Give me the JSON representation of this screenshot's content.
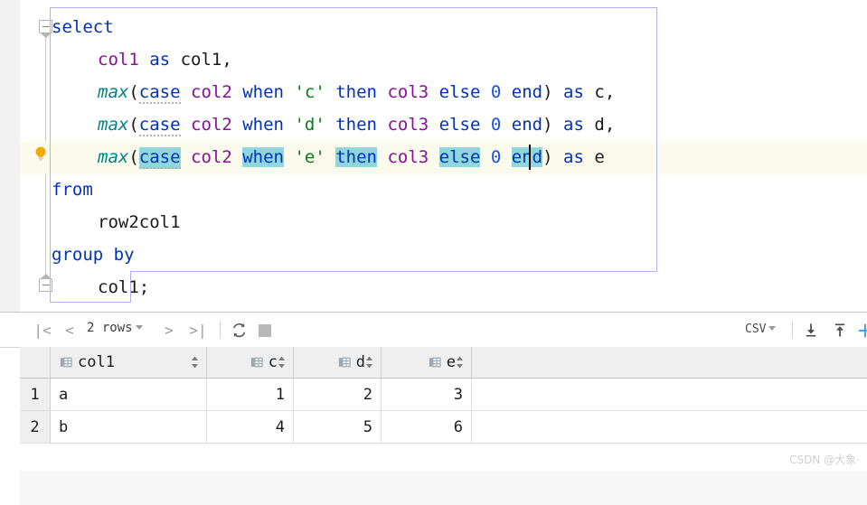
{
  "editor": {
    "language": "sql",
    "lines": [
      {
        "indent": 0,
        "tokens": [
          {
            "t": "select",
            "c": "kw"
          }
        ]
      },
      {
        "indent": 1,
        "tokens": [
          {
            "t": "col1",
            "c": "col"
          },
          {
            "t": " ",
            "c": "pln"
          },
          {
            "t": "as",
            "c": "kw"
          },
          {
            "t": " ",
            "c": "pln"
          },
          {
            "t": "col1",
            "c": "pln"
          },
          {
            "t": ",",
            "c": "pln"
          }
        ]
      },
      {
        "indent": 1,
        "tokens": [
          {
            "t": "max",
            "c": "fn"
          },
          {
            "t": "(",
            "c": "pln"
          },
          {
            "t": "case",
            "c": "kw sq"
          },
          {
            "t": " ",
            "c": "pln"
          },
          {
            "t": "col2",
            "c": "col"
          },
          {
            "t": " ",
            "c": "pln"
          },
          {
            "t": "when",
            "c": "kw"
          },
          {
            "t": " ",
            "c": "pln"
          },
          {
            "t": "'c'",
            "c": "str"
          },
          {
            "t": " ",
            "c": "pln"
          },
          {
            "t": "then",
            "c": "kw"
          },
          {
            "t": " ",
            "c": "pln"
          },
          {
            "t": "col3",
            "c": "col"
          },
          {
            "t": " ",
            "c": "pln"
          },
          {
            "t": "else",
            "c": "kw"
          },
          {
            "t": " ",
            "c": "pln"
          },
          {
            "t": "0",
            "c": "num"
          },
          {
            "t": " ",
            "c": "pln"
          },
          {
            "t": "end",
            "c": "kw"
          },
          {
            "t": ")",
            "c": "pln"
          },
          {
            "t": " ",
            "c": "pln"
          },
          {
            "t": "as",
            "c": "kw"
          },
          {
            "t": " ",
            "c": "pln"
          },
          {
            "t": "c",
            "c": "pln"
          },
          {
            "t": ",",
            "c": "pln"
          }
        ]
      },
      {
        "indent": 1,
        "tokens": [
          {
            "t": "max",
            "c": "fn"
          },
          {
            "t": "(",
            "c": "pln"
          },
          {
            "t": "case",
            "c": "kw sq"
          },
          {
            "t": " ",
            "c": "pln"
          },
          {
            "t": "col2",
            "c": "col"
          },
          {
            "t": " ",
            "c": "pln"
          },
          {
            "t": "when",
            "c": "kw"
          },
          {
            "t": " ",
            "c": "pln"
          },
          {
            "t": "'d'",
            "c": "str"
          },
          {
            "t": " ",
            "c": "pln"
          },
          {
            "t": "then",
            "c": "kw"
          },
          {
            "t": " ",
            "c": "pln"
          },
          {
            "t": "col3",
            "c": "col"
          },
          {
            "t": " ",
            "c": "pln"
          },
          {
            "t": "else",
            "c": "kw"
          },
          {
            "t": " ",
            "c": "pln"
          },
          {
            "t": "0",
            "c": "num"
          },
          {
            "t": " ",
            "c": "pln"
          },
          {
            "t": "end",
            "c": "kw"
          },
          {
            "t": ")",
            "c": "pln"
          },
          {
            "t": " ",
            "c": "pln"
          },
          {
            "t": "as",
            "c": "kw"
          },
          {
            "t": " ",
            "c": "pln"
          },
          {
            "t": "d",
            "c": "pln"
          },
          {
            "t": ",",
            "c": "pln"
          }
        ]
      },
      {
        "indent": 1,
        "tokens": [
          {
            "t": "max",
            "c": "fn"
          },
          {
            "t": "(",
            "c": "pln"
          },
          {
            "t": "case",
            "c": "kw sq hi"
          },
          {
            "t": " ",
            "c": "pln"
          },
          {
            "t": "col2",
            "c": "col"
          },
          {
            "t": " ",
            "c": "pln"
          },
          {
            "t": "when",
            "c": "kw hi"
          },
          {
            "t": " ",
            "c": "pln"
          },
          {
            "t": "'e'",
            "c": "str"
          },
          {
            "t": " ",
            "c": "pln"
          },
          {
            "t": "then",
            "c": "kw hi"
          },
          {
            "t": " ",
            "c": "pln"
          },
          {
            "t": "col3",
            "c": "col"
          },
          {
            "t": " ",
            "c": "pln"
          },
          {
            "t": "else",
            "c": "kw hi"
          },
          {
            "t": " ",
            "c": "pln"
          },
          {
            "t": "0",
            "c": "num"
          },
          {
            "t": " ",
            "c": "pln"
          },
          {
            "t": "end",
            "c": "kw hi"
          },
          {
            "t": ")",
            "c": "pln"
          },
          {
            "t": " ",
            "c": "pln"
          },
          {
            "t": "as",
            "c": "kw"
          },
          {
            "t": " ",
            "c": "pln"
          },
          {
            "t": "e",
            "c": "pln"
          }
        ]
      },
      {
        "indent": 0,
        "tokens": [
          {
            "t": "from",
            "c": "kw"
          }
        ]
      },
      {
        "indent": 1,
        "tokens": [
          {
            "t": "row2col1",
            "c": "pln"
          }
        ]
      },
      {
        "indent": 0,
        "tokens": [
          {
            "t": "group by",
            "c": "kw"
          }
        ]
      },
      {
        "indent": 1,
        "tokens": [
          {
            "t": "col1",
            "c": "pln"
          },
          {
            "t": ";",
            "c": "pln"
          }
        ]
      }
    ],
    "gutter": {
      "fold_open_label": "collapse-select-block",
      "fold_close_label": "collapse-end-marker",
      "intention_hint": "show-intention-actions"
    }
  },
  "results": {
    "toolbar": {
      "first_page": "|<",
      "prev_page": "<",
      "rows_label": "2 rows",
      "next_page": ">",
      "last_page": ">|",
      "reload": "reload",
      "stop": "stop",
      "format_label": "CSV",
      "download": "download",
      "upload": "upload",
      "add": "add"
    },
    "grid": {
      "columns": [
        {
          "label": "col1",
          "align": "left"
        },
        {
          "label": "c",
          "align": "right"
        },
        {
          "label": "d",
          "align": "right"
        },
        {
          "label": "e",
          "align": "right"
        }
      ],
      "rows": [
        {
          "num": "1",
          "cells": [
            "a",
            "1",
            "2",
            "3"
          ]
        },
        {
          "num": "2",
          "cells": [
            "b",
            "4",
            "5",
            "6"
          ]
        }
      ]
    }
  },
  "watermark": {
    "text": "CSDN @大象·"
  },
  "colors": {
    "keyword": "#0033b3",
    "function": "#00828c",
    "column": "#871094",
    "string": "#067d17",
    "number": "#1750eb",
    "highlight": "#8fd6dd",
    "current_line": "#fcfaec",
    "scope_border": "#b3b0f0",
    "bulb": "#f2a900",
    "accent": "#3b9cf5"
  }
}
